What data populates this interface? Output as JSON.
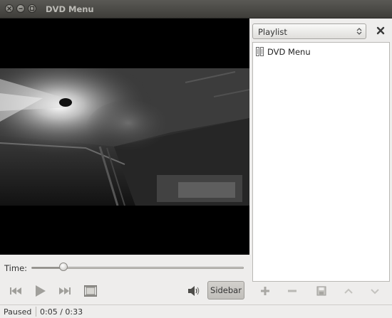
{
  "window": {
    "title": "DVD Menu",
    "controls": [
      "close-icon",
      "minimize-icon",
      "maximize-icon"
    ]
  },
  "sidebar": {
    "selector_value": "Playlist",
    "items": [
      {
        "label": "DVD Menu",
        "icon": "disc-icon"
      }
    ],
    "toolbar_icons": [
      "add-icon",
      "remove-icon",
      "save-icon",
      "move-up-icon",
      "move-down-icon"
    ]
  },
  "seek": {
    "label": "Time:",
    "progress": 0.15
  },
  "controls": {
    "icons": [
      "previous-icon",
      "play-icon",
      "next-icon",
      "fullscreen-icon",
      "volume-icon"
    ],
    "sidebar_label": "Sidebar"
  },
  "status": {
    "state": "Paused",
    "time": "0:05 / 0:33"
  }
}
